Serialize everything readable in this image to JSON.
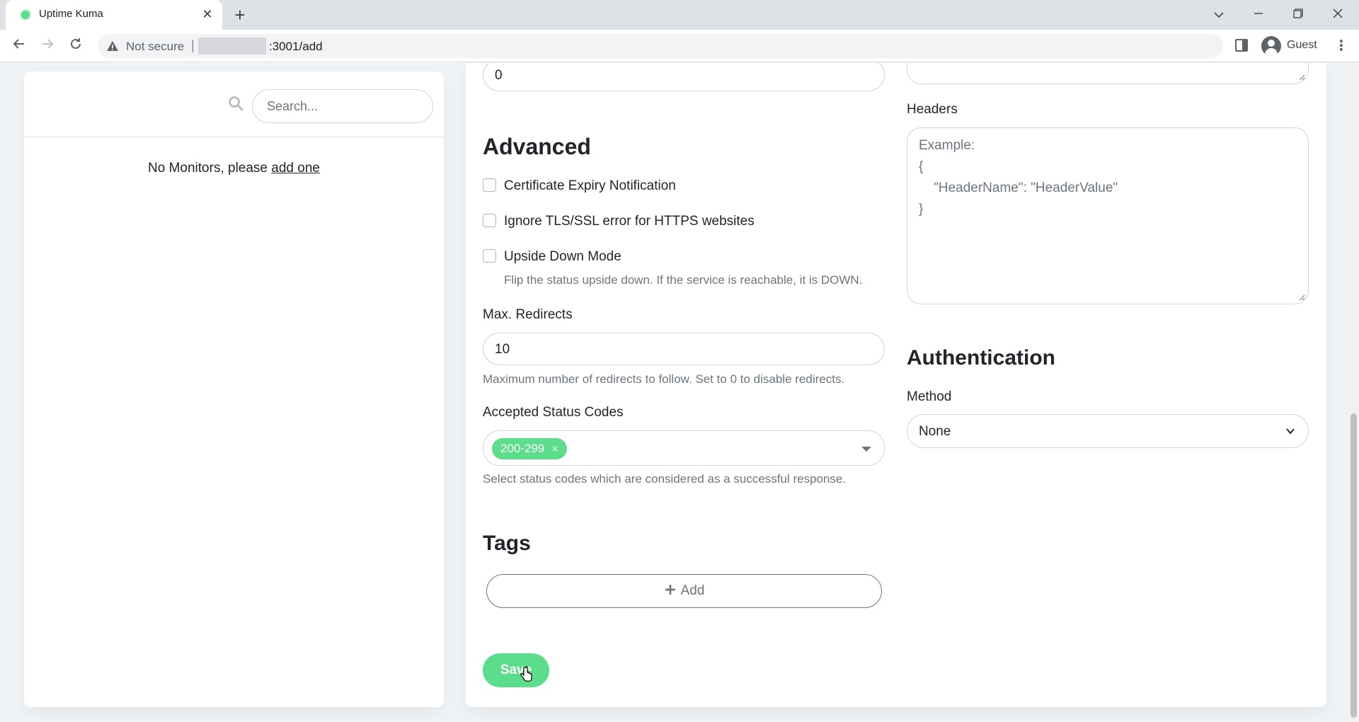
{
  "browser": {
    "tab_title": "Uptime Kuma",
    "new_tab_label": "+",
    "omnibox_security": "Not secure",
    "omnibox_separator": "|",
    "omnibox_url": ":3001/add",
    "profile_name": "Guest"
  },
  "sidebar": {
    "search_placeholder": "Search...",
    "empty_text": "No Monitors, please ",
    "empty_link": "add one"
  },
  "form": {
    "top_input_value": "0",
    "advanced_title": "Advanced",
    "checkboxes": [
      {
        "label": "Certificate Expiry Notification",
        "checked": false
      },
      {
        "label": "Ignore TLS/SSL error for HTTPS websites",
        "checked": false
      },
      {
        "label": "Upside Down Mode",
        "checked": false
      }
    ],
    "upside_down_help": "Flip the status upside down. If the service is reachable, it is DOWN.",
    "max_redirects_label": "Max. Redirects",
    "max_redirects_value": "10",
    "max_redirects_help": "Maximum number of redirects to follow. Set to 0 to disable redirects.",
    "accepted_codes_label": "Accepted Status Codes",
    "accepted_codes_tag": "200-299",
    "accepted_codes_remove": "×",
    "accepted_codes_help": "Select status codes which are considered as a successful response.",
    "tags_title": "Tags",
    "add_tag_label": "Add",
    "save_label": "Save",
    "headers_label": "Headers",
    "headers_placeholder_lines": [
      "Example:",
      "{",
      "    \"HeaderName\": \"HeaderValue\"",
      "}"
    ],
    "auth_title": "Authentication",
    "method_label": "Method",
    "method_value": "None"
  },
  "colors": {
    "accent": "#5cdd8b",
    "page_bg": "#f0f3f6",
    "muted": "#6c757d"
  },
  "icons": [
    "search-icon",
    "warning-icon",
    "back-icon",
    "forward-icon",
    "reload-icon",
    "side-panel-icon",
    "avatar-icon",
    "plus-icon",
    "chevron-down-icon",
    "close-icon"
  ]
}
